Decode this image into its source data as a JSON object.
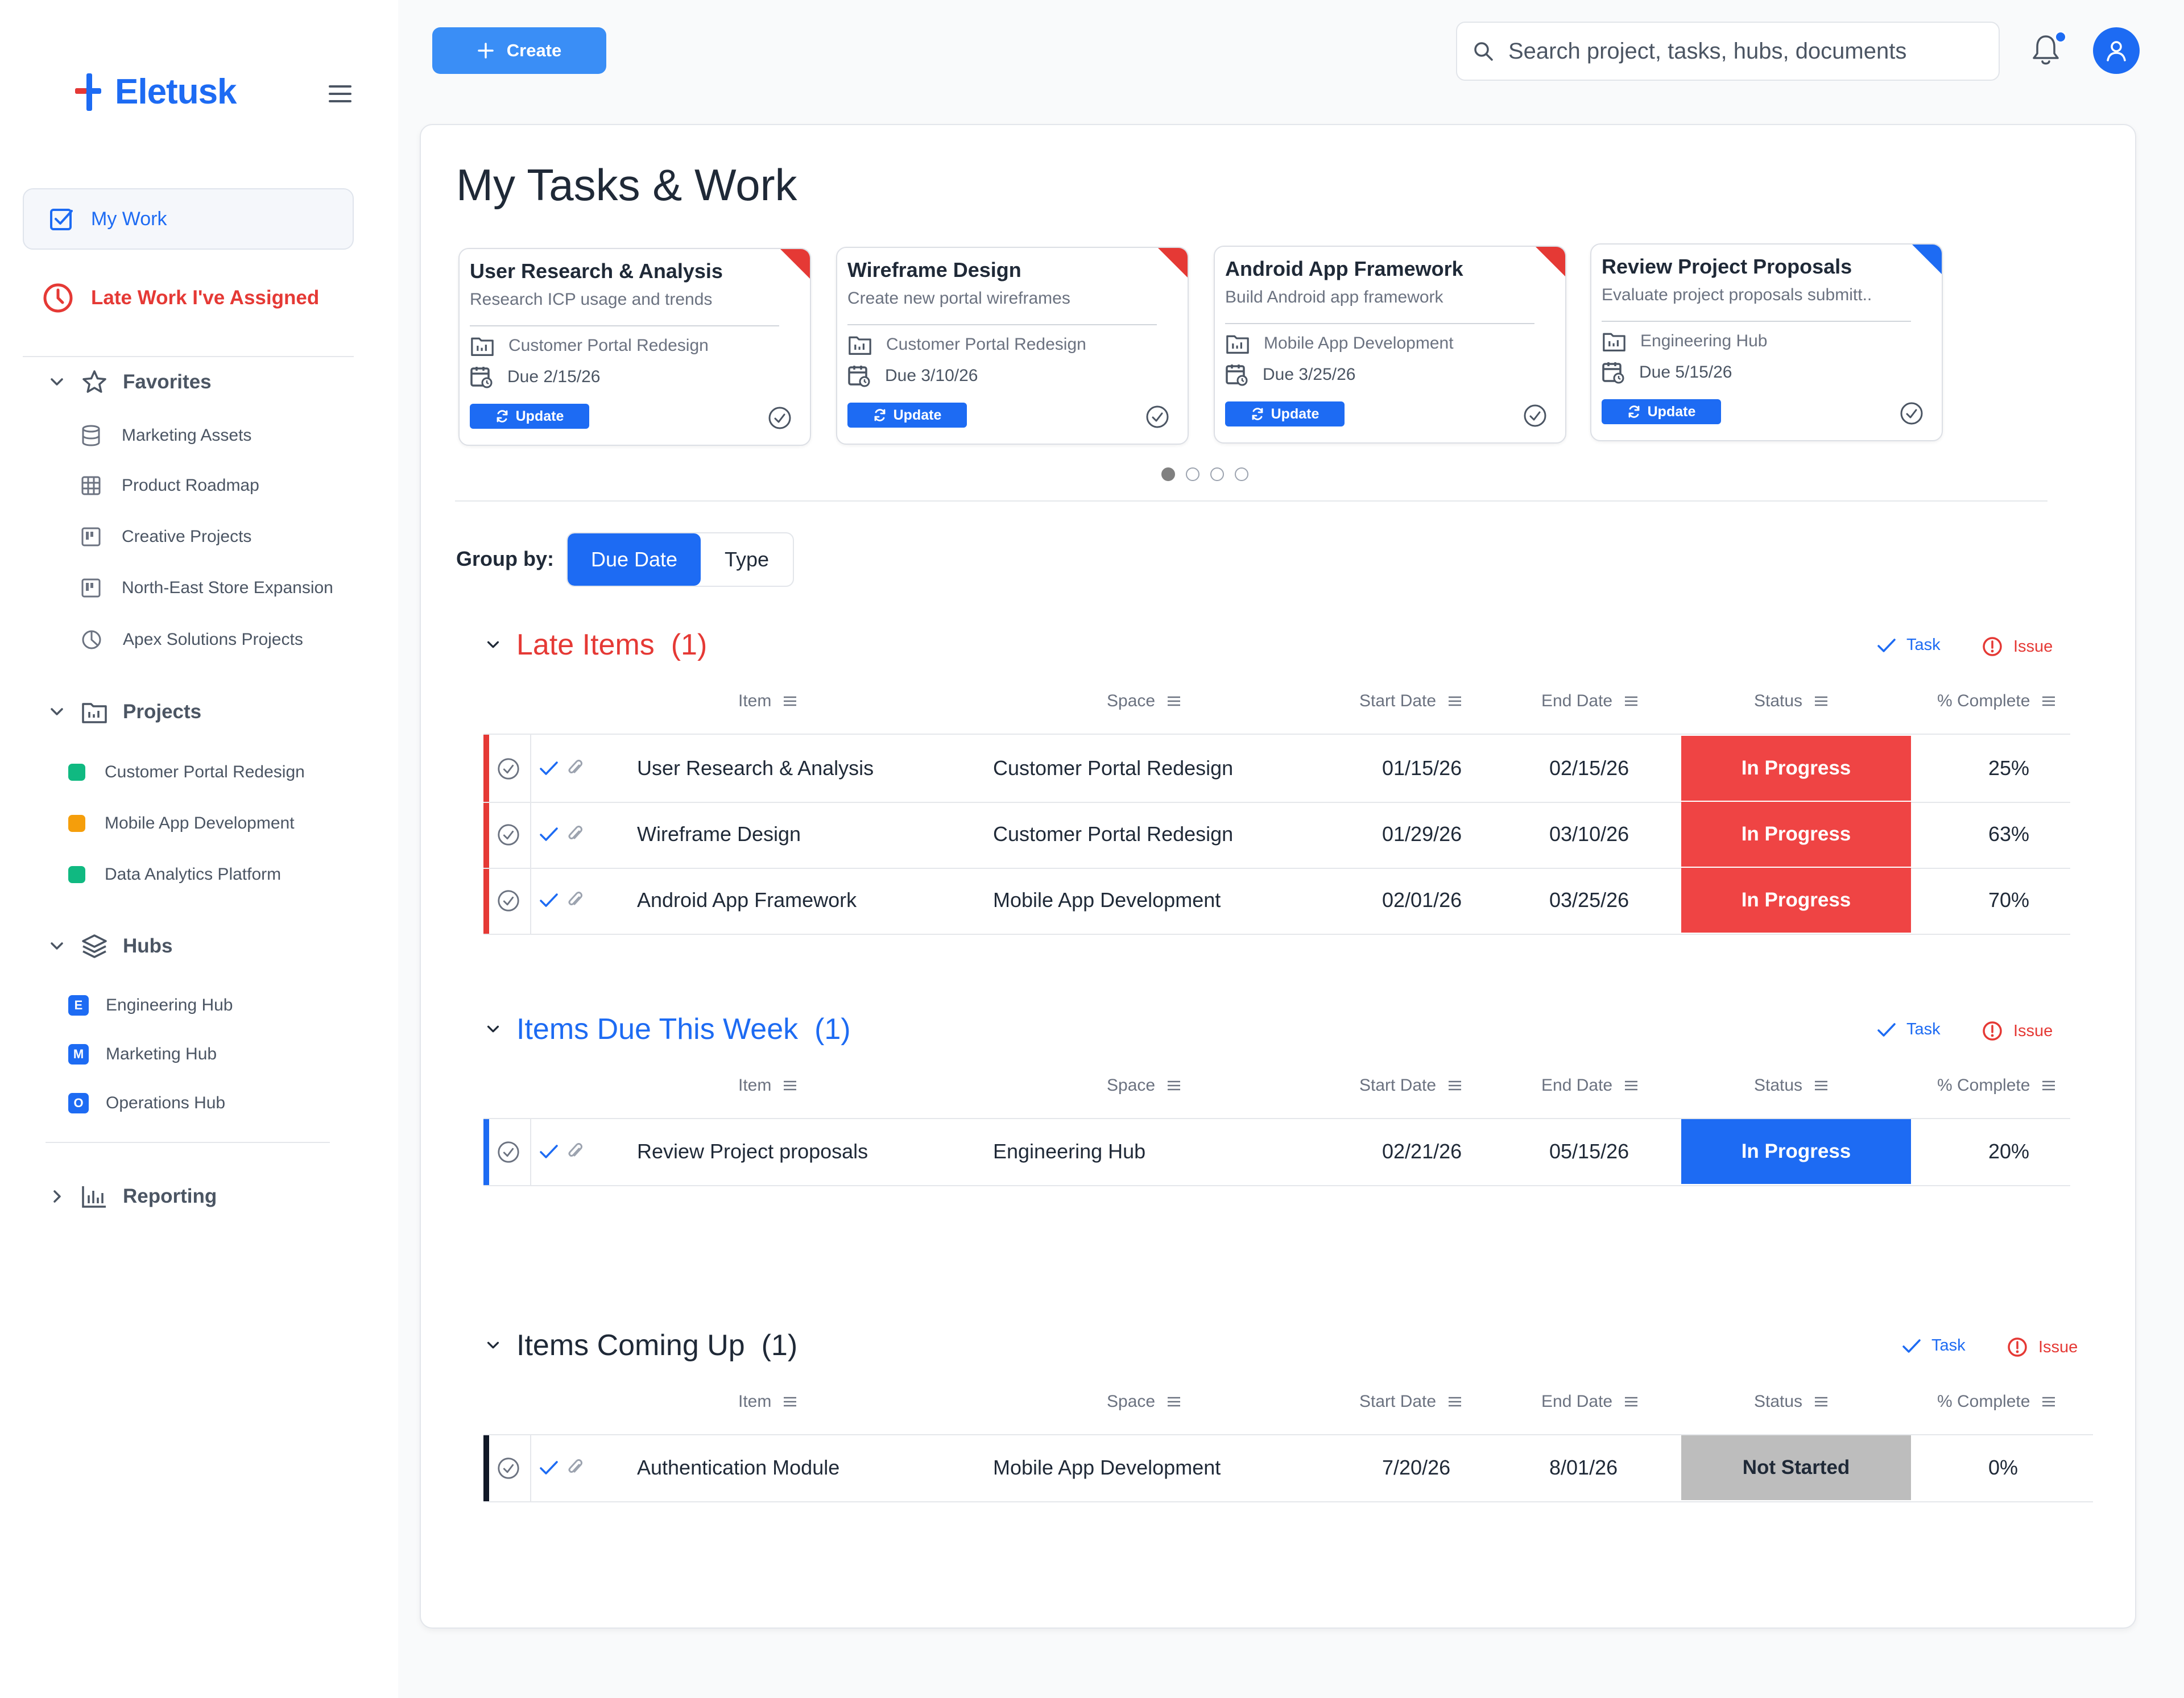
{
  "app": {
    "name": "Eletusk"
  },
  "topbar": {
    "create_label": "Create",
    "search_placeholder": "Search project, tasks, hubs, documents"
  },
  "sidebar": {
    "my_work": "My Work",
    "late_work": "Late Work I've Assigned",
    "favorites": {
      "title": "Favorites",
      "items": [
        "Marketing Assets",
        "Product Roadmap",
        "Creative Projects",
        "North-East Store Expansion",
        "Apex Solutions Projects"
      ]
    },
    "projects": {
      "title": "Projects",
      "items": [
        {
          "label": "Customer Portal Redesign",
          "color": "#10b981"
        },
        {
          "label": "Mobile App Development",
          "color": "#f59e0b"
        },
        {
          "label": "Data Analytics Platform",
          "color": "#10b981"
        }
      ]
    },
    "hubs": {
      "title": "Hubs",
      "items": [
        {
          "badge": "E",
          "label": "Engineering Hub"
        },
        {
          "badge": "M",
          "label": "Marketing Hub"
        },
        {
          "badge": "O",
          "label": "Operations Hub"
        }
      ]
    },
    "reporting": "Reporting"
  },
  "main": {
    "title": "My Tasks & Work",
    "cards": [
      {
        "title": "User Research & Analysis",
        "desc": "Research ICP usage and trends",
        "space": "Customer Portal Redesign",
        "due": "Due 2/15/26",
        "update": "Update",
        "corner": "#e53935"
      },
      {
        "title": "Wireframe Design",
        "desc": "Create new portal wireframes",
        "space": "Customer Portal Redesign",
        "due": "Due 3/10/26",
        "update": "Update",
        "corner": "#e53935"
      },
      {
        "title": "Android App Framework",
        "desc": "Build Android app framework",
        "space": "Mobile App Development",
        "due": "Due 3/25/26",
        "update": "Update",
        "corner": "#e53935"
      },
      {
        "title": "Review Project Proposals",
        "desc": "Evaluate project proposals submitt..",
        "space": "Engineering Hub",
        "due": "Due 5/15/26",
        "update": "Update",
        "corner": "#1d6bf3"
      }
    ],
    "group_by": {
      "label": "Group by:",
      "options": [
        "Due Date",
        "Type"
      ],
      "selected": "Due Date"
    },
    "columns": [
      "Item",
      "Space",
      "Start Date",
      "End Date",
      "Status",
      "% Complete"
    ],
    "legend": {
      "task": "Task",
      "issue": "Issue"
    },
    "groups": [
      {
        "title": "Late Items",
        "count": "(1)",
        "color": "#e53935",
        "rows": [
          {
            "item": "User Research & Analysis",
            "space": "Customer Portal Redesign",
            "start": "01/15/26",
            "end": "02/15/26",
            "status": "In Progress",
            "complete": "25%"
          },
          {
            "item": "Wireframe Design",
            "space": "Customer Portal Redesign",
            "start": "01/29/26",
            "end": "03/10/26",
            "status": "In Progress",
            "complete": "63%"
          },
          {
            "item": "Android App Framework",
            "space": "Mobile App Development",
            "start": "02/01/26",
            "end": "03/25/26",
            "status": "In Progress",
            "complete": "70%"
          }
        ]
      },
      {
        "title": "Items Due This Week",
        "count": "(1)",
        "color": "#1d6bf3",
        "rows": [
          {
            "item": "Review Project proposals",
            "space": "Engineering Hub",
            "start": "02/21/26",
            "end": "05/15/26",
            "status": "In Progress",
            "complete": "20%"
          }
        ]
      },
      {
        "title": "Items Coming Up",
        "count": "(1)",
        "color": "#1f2937",
        "rows": [
          {
            "item": "Authentication Module",
            "space": "Mobile App Development",
            "start": "7/20/26",
            "end": "8/01/26",
            "status": "Not Started",
            "complete": "0%"
          }
        ]
      }
    ]
  },
  "colors": {
    "accent": "#1d6bf3",
    "late": "#e53935",
    "in_progress_late": "#ef4444",
    "in_progress": "#1d6bf3",
    "not_started": "#bdbdbd"
  }
}
